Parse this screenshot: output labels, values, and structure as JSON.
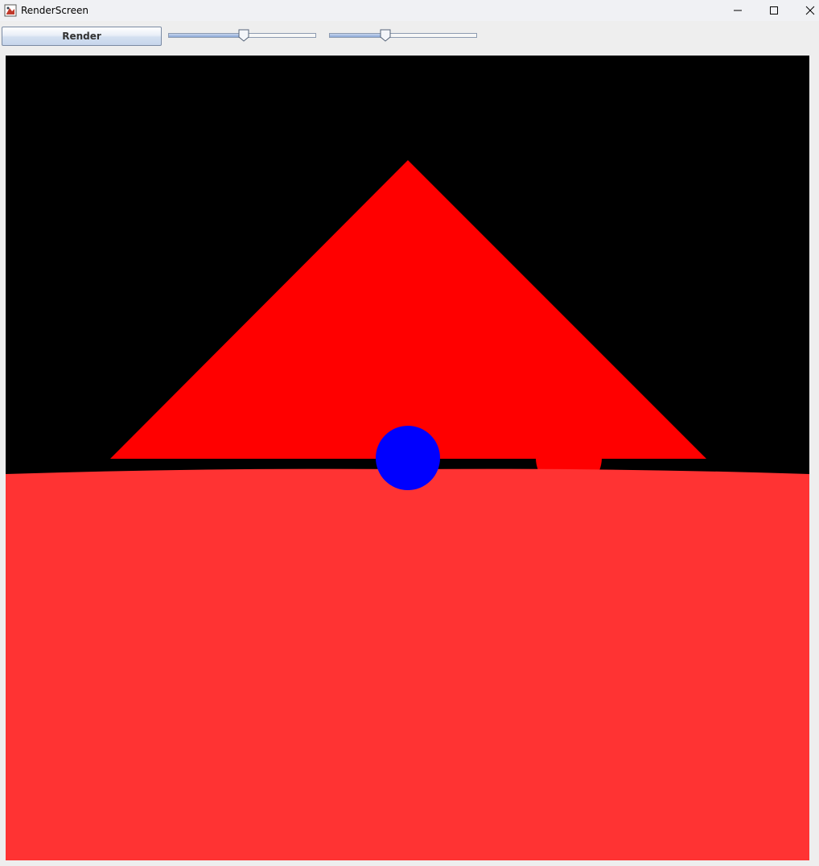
{
  "window": {
    "title": "RenderScreen",
    "icon": "java-app-icon",
    "controls": [
      "minimize-icon",
      "maximize-icon",
      "close-icon"
    ]
  },
  "toolbar": {
    "render_label": "Render",
    "sliders": [
      {
        "value_fraction": 0.51
      },
      {
        "value_fraction": 0.38
      }
    ]
  },
  "scene": {
    "background_color": "#000000",
    "floor_color": "#ff3333",
    "triangle_color": "#ff0000",
    "sphere_blue_color": "#0000ff",
    "sphere_red_color": "#ff0000"
  }
}
